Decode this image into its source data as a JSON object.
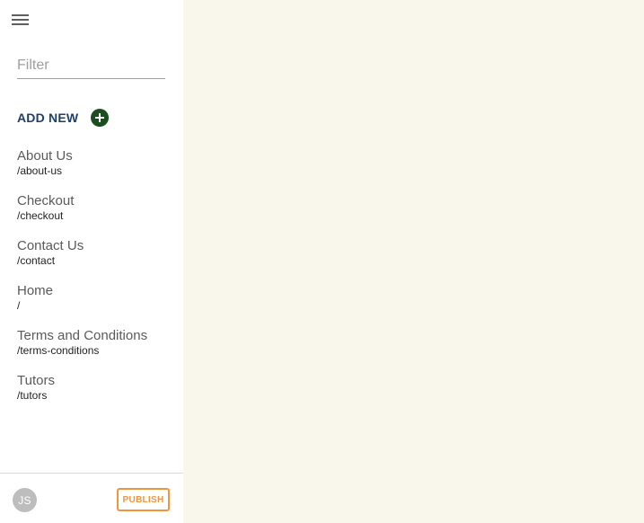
{
  "sidebar": {
    "filter": {
      "placeholder": "Filter",
      "value": ""
    },
    "add_new_label": "ADD NEW",
    "pages": [
      {
        "title": "About Us",
        "path": "/about-us"
      },
      {
        "title": "Checkout",
        "path": "/checkout"
      },
      {
        "title": "Contact Us",
        "path": "/contact"
      },
      {
        "title": "Home",
        "path": "/"
      },
      {
        "title": "Terms and Conditions",
        "path": "/terms-conditions"
      },
      {
        "title": "Tutors",
        "path": "/tutors"
      }
    ]
  },
  "footer": {
    "avatar_initials": "JS",
    "publish_label": "PUBLISH"
  },
  "colors": {
    "accent_publish": "#f2953c",
    "add_new_text": "#1f3f6b",
    "add_icon": "#1b4d1f",
    "canvas_background": "#f9f7ec"
  },
  "icons": {
    "menu": "hamburger-menu-icon",
    "add": "plus-circle-icon"
  }
}
